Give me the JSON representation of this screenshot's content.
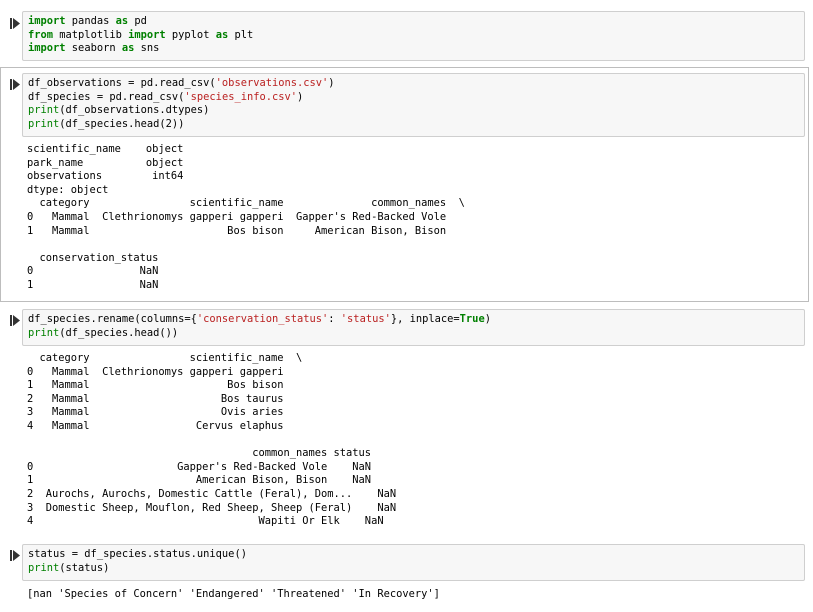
{
  "cells": [
    {
      "code": [
        {
          "tokens": [
            [
              "kw",
              "import"
            ],
            [
              "",
              " pandas "
            ],
            [
              "kw",
              "as"
            ],
            [
              "",
              " pd"
            ]
          ]
        },
        {
          "tokens": [
            [
              "kw",
              "from"
            ],
            [
              "",
              " matplotlib "
            ],
            [
              "kw",
              "import"
            ],
            [
              "",
              " pyplot "
            ],
            [
              "kw",
              "as"
            ],
            [
              "",
              " plt"
            ]
          ]
        },
        {
          "tokens": [
            [
              "kw",
              "import"
            ],
            [
              "",
              " seaborn "
            ],
            [
              "kw",
              "as"
            ],
            [
              "",
              " sns"
            ]
          ]
        }
      ],
      "output": []
    },
    {
      "code": [
        {
          "tokens": [
            [
              "",
              "df_observations = pd.read_csv("
            ],
            [
              "str",
              "'observations.csv'"
            ],
            [
              "",
              ")"
            ]
          ]
        },
        {
          "tokens": [
            [
              "",
              "df_species = pd.read_csv("
            ],
            [
              "str",
              "'species_info.csv'"
            ],
            [
              "",
              ")"
            ]
          ]
        },
        {
          "tokens": [
            [
              "bi",
              "print"
            ],
            [
              "",
              "(df_observations.dtypes)"
            ]
          ]
        },
        {
          "tokens": [
            [
              "bi",
              "print"
            ],
            [
              "",
              "(df_species.head(2))"
            ]
          ]
        }
      ],
      "output": [
        "scientific_name    object",
        "park_name          object",
        "observations        int64",
        "dtype: object",
        "  category                scientific_name              common_names  \\",
        "0   Mammal  Clethrionomys gapperi gapperi  Gapper's Red-Backed Vole",
        "1   Mammal                      Bos bison     American Bison, Bison",
        "",
        "  conservation_status",
        "0                 NaN",
        "1                 NaN"
      ]
    },
    {
      "code": [
        {
          "tokens": [
            [
              "",
              "df_species.rename(columns={"
            ],
            [
              "str",
              "'conservation_status'"
            ],
            [
              "",
              ": "
            ],
            [
              "str",
              "'status'"
            ],
            [
              "",
              "}, inplace="
            ],
            [
              "kw",
              "True"
            ],
            [
              "",
              ")"
            ]
          ]
        },
        {
          "tokens": [
            [
              "bi",
              "print"
            ],
            [
              "",
              "(df_species.head())"
            ]
          ]
        }
      ],
      "output": [
        "  category                scientific_name  \\",
        "0   Mammal  Clethrionomys gapperi gapperi",
        "1   Mammal                      Bos bison",
        "2   Mammal                     Bos taurus",
        "3   Mammal                     Ovis aries",
        "4   Mammal                 Cervus elaphus",
        "",
        "                                    common_names status",
        "0                       Gapper's Red-Backed Vole    NaN",
        "1                          American Bison, Bison    NaN",
        "2  Aurochs, Aurochs, Domestic Cattle (Feral), Dom...    NaN",
        "3  Domestic Sheep, Mouflon, Red Sheep, Sheep (Feral)    NaN",
        "4                                    Wapiti Or Elk    NaN"
      ]
    },
    {
      "code": [
        {
          "tokens": [
            [
              "",
              "status = df_species.status.unique()"
            ]
          ]
        },
        {
          "tokens": [
            [
              "bi",
              "print"
            ],
            [
              "",
              "(status)"
            ]
          ]
        }
      ],
      "output": [
        "[nan 'Species of Concern' 'Endangered' 'Threatened' 'In Recovery']"
      ]
    }
  ]
}
